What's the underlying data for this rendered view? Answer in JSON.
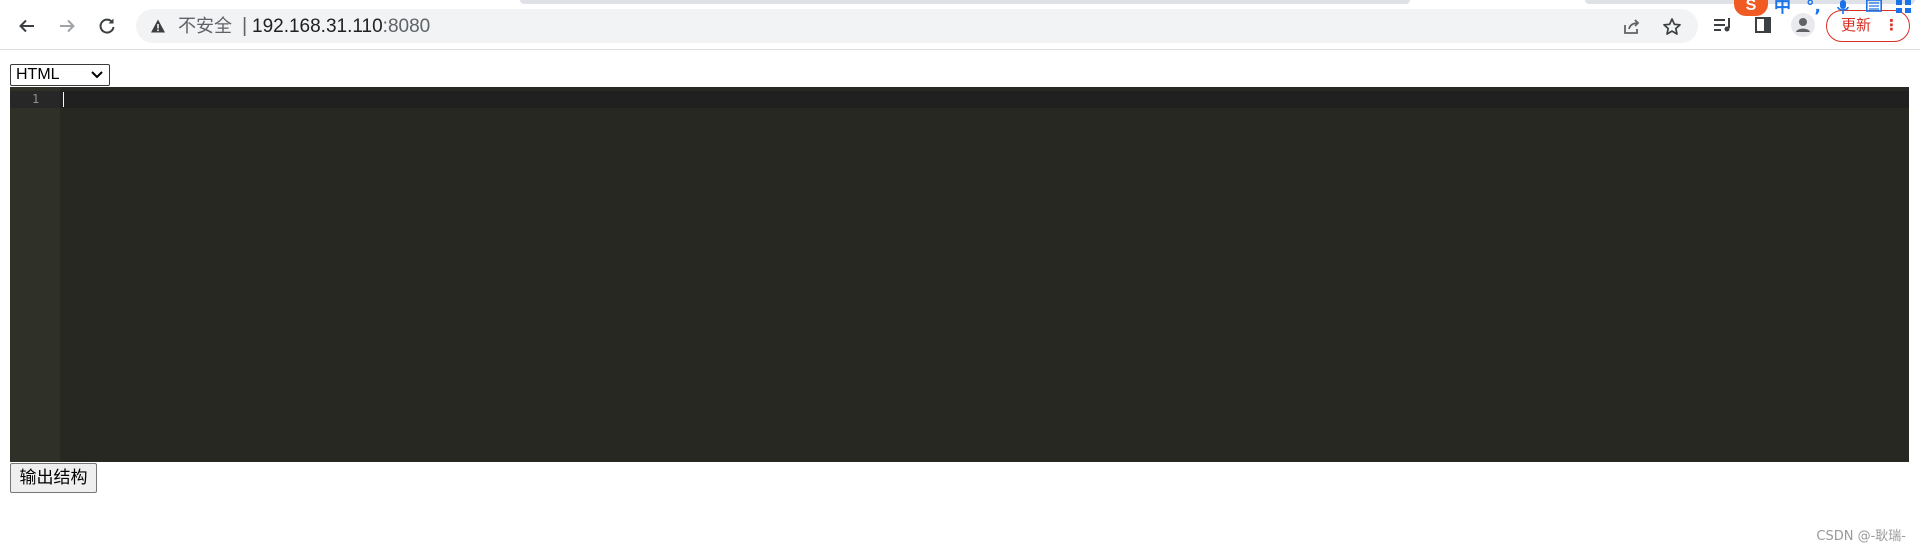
{
  "browser": {
    "security_label": "不安全",
    "separator": "|",
    "url_host": "192.168.31.110",
    "url_port": ":8080",
    "update_label": "更新",
    "update_menu": "⋮",
    "icons": {
      "back": "back-arrow-icon",
      "forward": "forward-arrow-icon",
      "reload": "reload-icon",
      "warning": "warning-triangle-icon",
      "share": "share-icon",
      "bookmark": "star-icon",
      "reading_list": "reading-list-icon",
      "side_panel": "side-panel-icon",
      "profile": "profile-icon"
    },
    "ime": {
      "logo": "S",
      "mode": "中",
      "punct": "°,",
      "mic": "microphone-icon",
      "keyboard": "keyboard-icon",
      "grid": "grid-icon"
    }
  },
  "page": {
    "language_select": {
      "selected": "HTML"
    },
    "editor": {
      "line_numbers": [
        "1"
      ],
      "content": "",
      "theme_colors": {
        "background": "#272822",
        "gutter": "#2f3129",
        "line_number": "#8f908a"
      }
    },
    "output_button_label": "输出结构",
    "watermark": "CSDN @-耿瑞-"
  }
}
